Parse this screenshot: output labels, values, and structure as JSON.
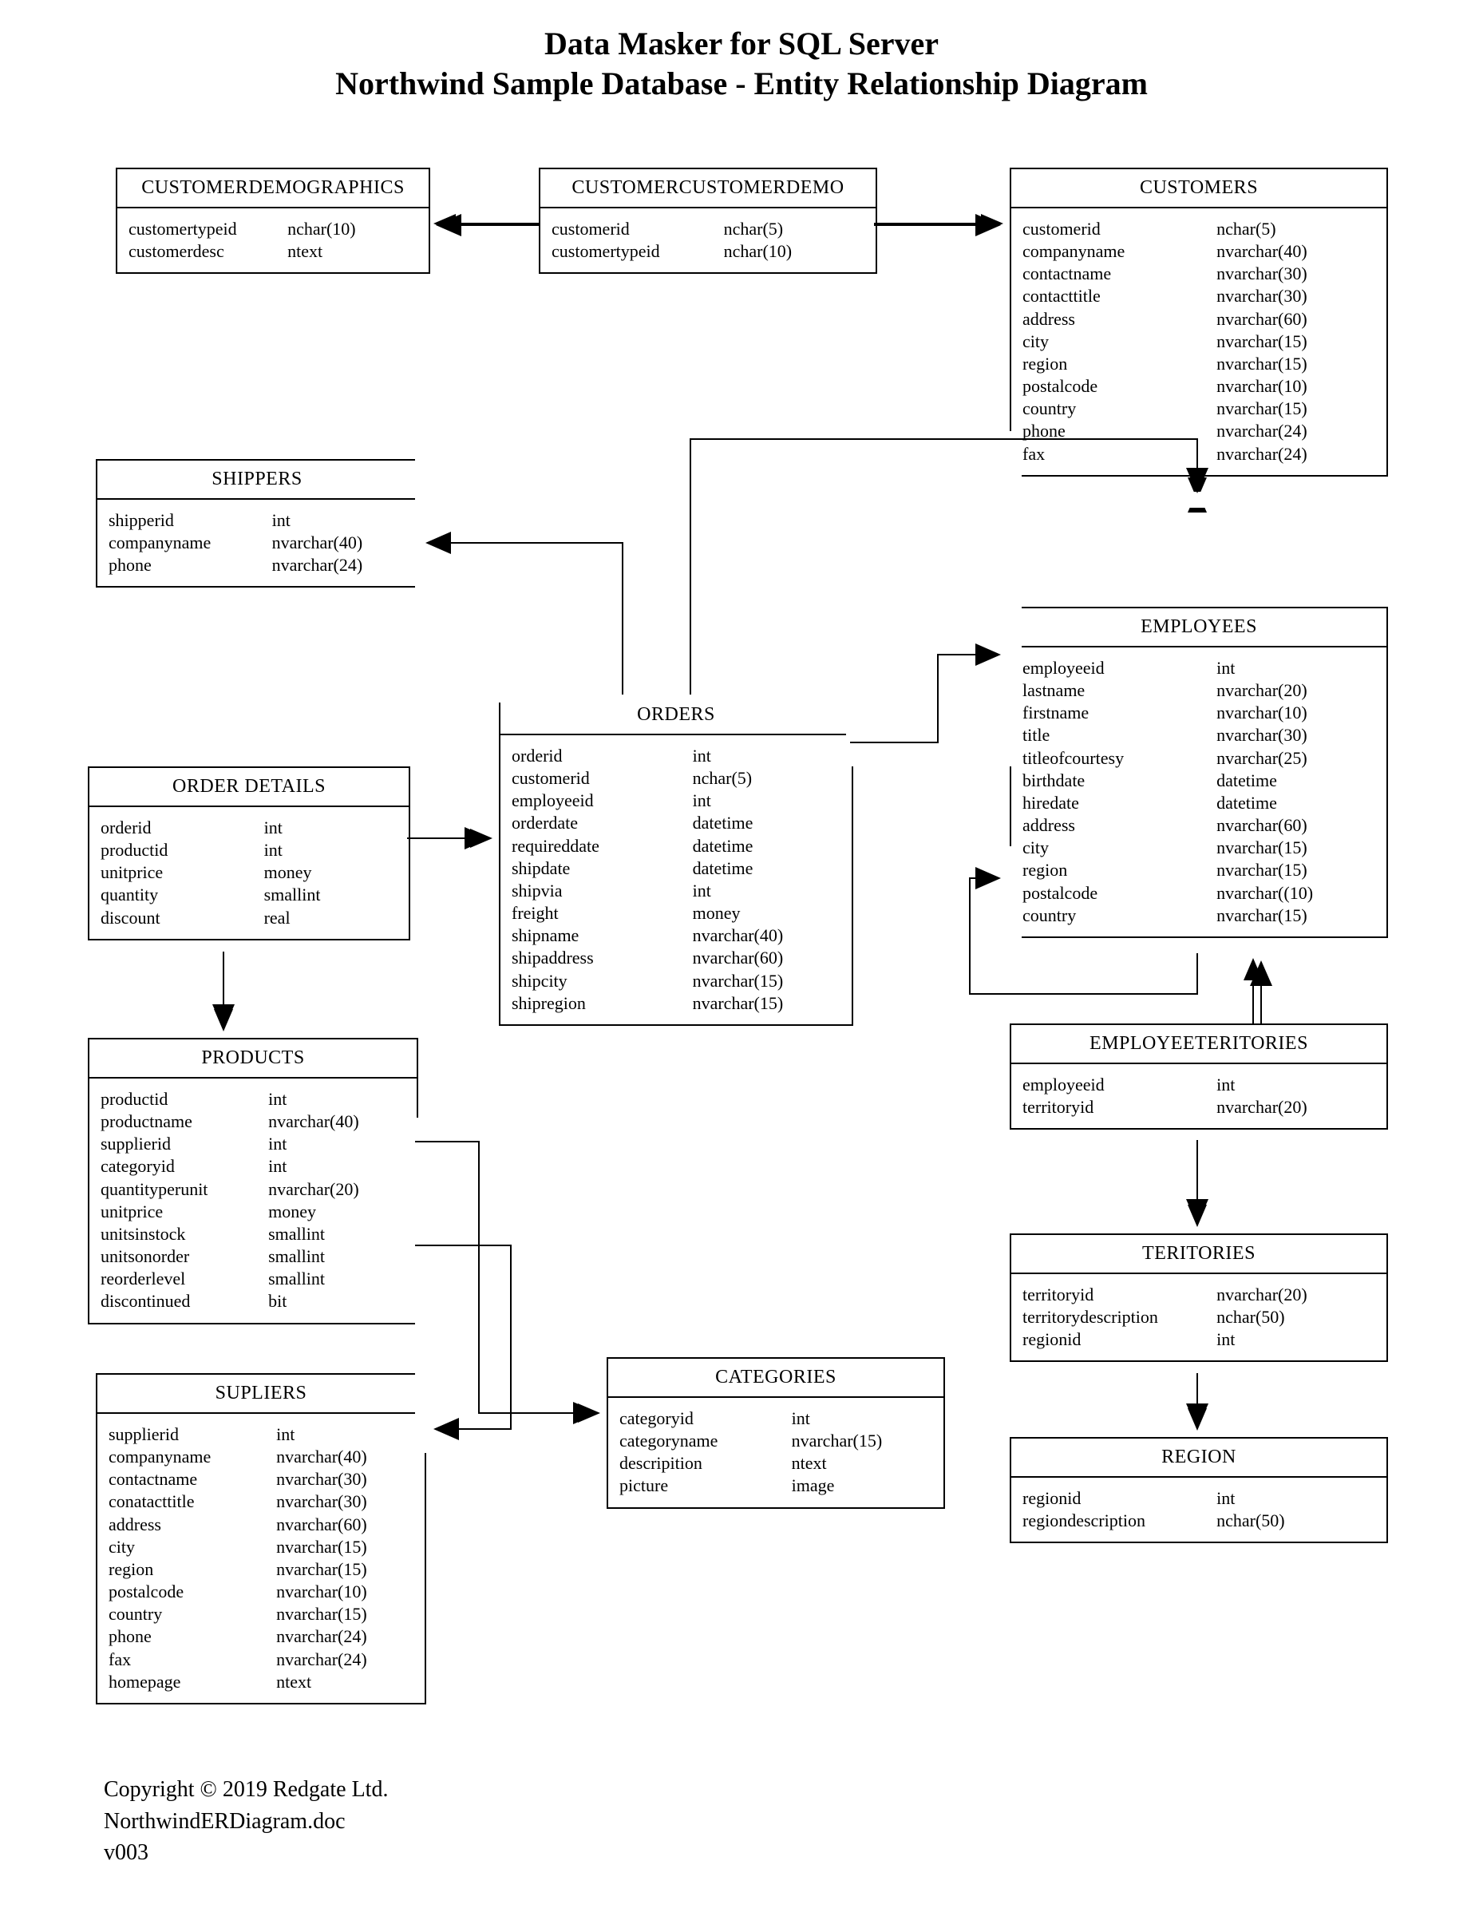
{
  "title": {
    "line1": "Data Masker for SQL Server",
    "line2": "Northwind Sample Database - Entity Relationship Diagram"
  },
  "entities": {
    "customerdemographics": {
      "name": "CUSTOMERDEMOGRAPHICS",
      "cols": [
        {
          "n": "customertypeid",
          "t": "nchar(10)"
        },
        {
          "n": "customerdesc",
          "t": "ntext"
        }
      ]
    },
    "customercustomerdemo": {
      "name": "CUSTOMERCUSTOMERDEMO",
      "cols": [
        {
          "n": "customerid",
          "t": "nchar(5)"
        },
        {
          "n": "customertypeid",
          "t": "nchar(10)"
        }
      ]
    },
    "customers": {
      "name": "CUSTOMERS",
      "cols": [
        {
          "n": "customerid",
          "t": "nchar(5)"
        },
        {
          "n": "companyname",
          "t": "nvarchar(40)"
        },
        {
          "n": "contactname",
          "t": "nvarchar(30)"
        },
        {
          "n": "contacttitle",
          "t": "nvarchar(30)"
        },
        {
          "n": "address",
          "t": "nvarchar(60)"
        },
        {
          "n": "city",
          "t": "nvarchar(15)"
        },
        {
          "n": "region",
          "t": "nvarchar(15)"
        },
        {
          "n": "postalcode",
          "t": "nvarchar(10)"
        },
        {
          "n": "country",
          "t": "nvarchar(15)"
        },
        {
          "n": "phone",
          "t": "nvarchar(24)"
        },
        {
          "n": "fax",
          "t": "nvarchar(24)"
        }
      ]
    },
    "shippers": {
      "name": "SHIPPERS",
      "cols": [
        {
          "n": "shipperid",
          "t": "int"
        },
        {
          "n": "companyname",
          "t": "nvarchar(40)"
        },
        {
          "n": "phone",
          "t": "nvarchar(24)"
        }
      ]
    },
    "employees": {
      "name": "EMPLOYEES",
      "cols": [
        {
          "n": "employeeid",
          "t": "int"
        },
        {
          "n": "lastname",
          "t": "nvarchar(20)"
        },
        {
          "n": "firstname",
          "t": "nvarchar(10)"
        },
        {
          "n": "title",
          "t": "nvarchar(30)"
        },
        {
          "n": "titleofcourtesy",
          "t": "nvarchar(25)"
        },
        {
          "n": "birthdate",
          "t": "datetime"
        },
        {
          "n": "hiredate",
          "t": "datetime"
        },
        {
          "n": "address",
          "t": "nvarchar(60)"
        },
        {
          "n": "city",
          "t": "nvarchar(15)"
        },
        {
          "n": "region",
          "t": "nvarchar(15)"
        },
        {
          "n": "postalcode",
          "t": "nvarchar((10)"
        },
        {
          "n": "country",
          "t": "nvarchar(15)"
        }
      ]
    },
    "orders": {
      "name": "ORDERS",
      "cols": [
        {
          "n": "orderid",
          "t": "int"
        },
        {
          "n": "customerid",
          "t": "nchar(5)"
        },
        {
          "n": "employeeid",
          "t": "int"
        },
        {
          "n": "orderdate",
          "t": "datetime"
        },
        {
          "n": "requireddate",
          "t": "datetime"
        },
        {
          "n": "shipdate",
          "t": "datetime"
        },
        {
          "n": "shipvia",
          "t": "int"
        },
        {
          "n": "freight",
          "t": "money"
        },
        {
          "n": "shipname",
          "t": "nvarchar(40)"
        },
        {
          "n": "shipaddress",
          "t": "nvarchar(60)"
        },
        {
          "n": "shipcity",
          "t": "nvarchar(15)"
        },
        {
          "n": "shipregion",
          "t": "nvarchar(15)"
        }
      ]
    },
    "orderdetails": {
      "name": "ORDER DETAILS",
      "cols": [
        {
          "n": "orderid",
          "t": "int"
        },
        {
          "n": "productid",
          "t": "int"
        },
        {
          "n": "unitprice",
          "t": "money"
        },
        {
          "n": "quantity",
          "t": "smallint"
        },
        {
          "n": "discount",
          "t": "real"
        }
      ]
    },
    "products": {
      "name": "PRODUCTS",
      "cols": [
        {
          "n": "productid",
          "t": "int"
        },
        {
          "n": "productname",
          "t": "nvarchar(40)"
        },
        {
          "n": "supplierid",
          "t": "int"
        },
        {
          "n": "categoryid",
          "t": "int"
        },
        {
          "n": "quantityperunit",
          "t": "nvarchar(20)"
        },
        {
          "n": "unitprice",
          "t": "money"
        },
        {
          "n": "unitsinstock",
          "t": "smallint"
        },
        {
          "n": "unitsonorder",
          "t": "smallint"
        },
        {
          "n": "reorderlevel",
          "t": "smallint"
        },
        {
          "n": "discontinued",
          "t": "bit"
        }
      ]
    },
    "employeeteritories": {
      "name": "EMPLOYEETERITORIES",
      "cols": [
        {
          "n": "employeeid",
          "t": "int"
        },
        {
          "n": "territoryid",
          "t": "nvarchar(20)"
        }
      ]
    },
    "teritories": {
      "name": "TERITORIES",
      "cols": [
        {
          "n": "territoryid",
          "t": "nvarchar(20)"
        },
        {
          "n": "territorydescription",
          "t": "nchar(50)"
        },
        {
          "n": "regionid",
          "t": "int"
        }
      ]
    },
    "categories": {
      "name": "CATEGORIES",
      "cols": [
        {
          "n": "categoryid",
          "t": "int"
        },
        {
          "n": "categoryname",
          "t": "nvarchar(15)"
        },
        {
          "n": "descripition",
          "t": "ntext"
        },
        {
          "n": "picture",
          "t": "image"
        }
      ]
    },
    "region": {
      "name": "REGION",
      "cols": [
        {
          "n": "regionid",
          "t": "int"
        },
        {
          "n": "regiondescription",
          "t": "nchar(50)"
        }
      ]
    },
    "supliers": {
      "name": "SUPLIERS",
      "cols": [
        {
          "n": "supplierid",
          "t": "int"
        },
        {
          "n": "companyname",
          "t": "nvarchar(40)"
        },
        {
          "n": "contactname",
          "t": "nvarchar(30)"
        },
        {
          "n": "conatacttitle",
          "t": "nvarchar(30)"
        },
        {
          "n": "address",
          "t": "nvarchar(60)"
        },
        {
          "n": "city",
          "t": "nvarchar(15)"
        },
        {
          "n": "region",
          "t": "nvarchar(15)"
        },
        {
          "n": "postalcode",
          "t": "nvarchar(10)"
        },
        {
          "n": "country",
          "t": "nvarchar(15)"
        },
        {
          "n": "phone",
          "t": "nvarchar(24)"
        },
        {
          "n": "fax",
          "t": "nvarchar(24)"
        },
        {
          "n": "homepage",
          "t": "ntext"
        }
      ]
    }
  },
  "footer": {
    "copyright": "Copyright © 2019 Redgate Ltd.",
    "filename": "NorthwindERDiagram.doc",
    "version": "v003"
  }
}
